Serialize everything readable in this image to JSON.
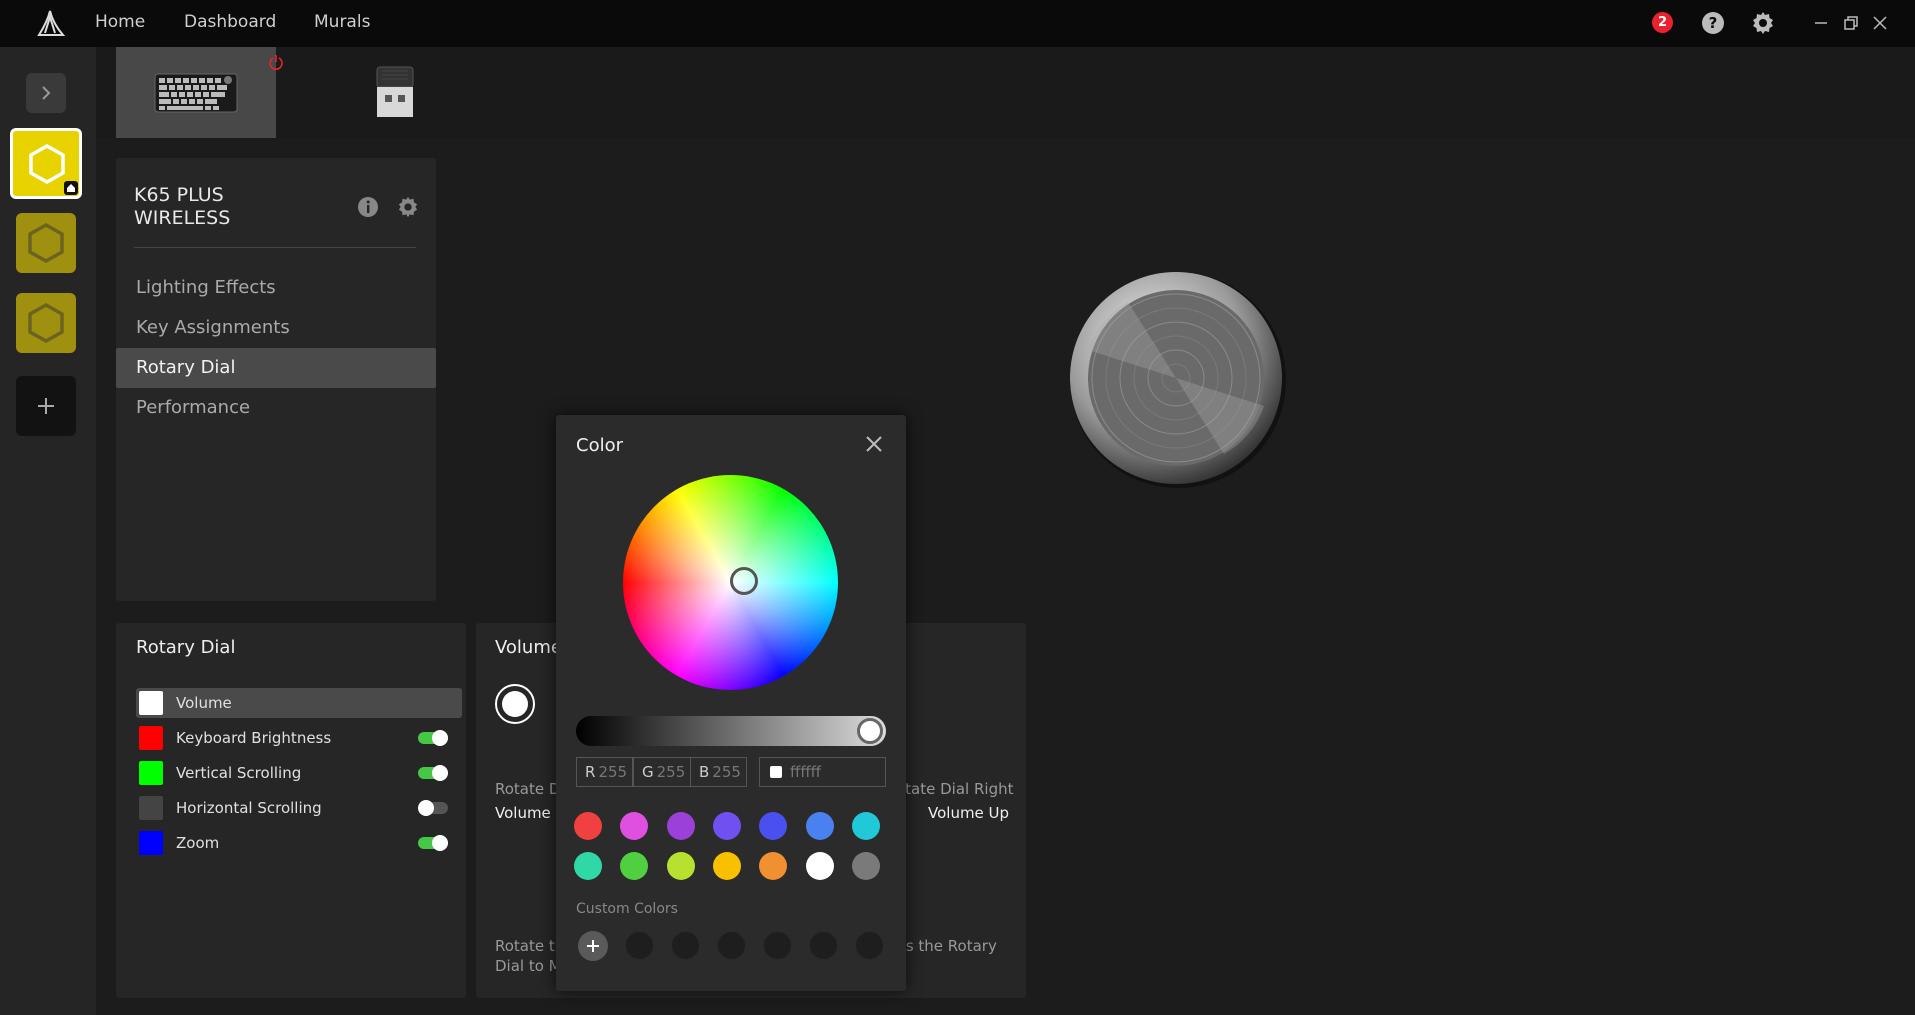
{
  "nav": {
    "home": "Home",
    "dashboard": "Dashboard",
    "murals": "Murals",
    "notification_count": "2"
  },
  "device": {
    "name_line1": "K65 PLUS",
    "name_line2": "WIRELESS",
    "menu": [
      "Lighting Effects",
      "Key Assignments",
      "Rotary Dial",
      "Performance"
    ],
    "active_menu": "Rotary Dial"
  },
  "rotary_dial": {
    "title": "Rotary Dial",
    "modes": [
      {
        "label": "Volume",
        "color": "#ffffff",
        "selected": true,
        "toggle": null
      },
      {
        "label": "Keyboard Brightness",
        "color": "#ff0000",
        "toggle": true
      },
      {
        "label": "Vertical Scrolling",
        "color": "#00ff00",
        "toggle": true
      },
      {
        "label": "Horizontal Scrolling",
        "color": "#444444",
        "toggle": false
      },
      {
        "label": "Zoom",
        "color": "#0000ff",
        "toggle": true
      }
    ]
  },
  "volume_panel": {
    "title": "Volume",
    "rotate_left_label": "Rotate D",
    "rotate_left_action": "Volume D",
    "rotate_right_label": "otate Dial Right",
    "rotate_right_action": "Volume Up",
    "press_text_left_1": "Rotate th",
    "press_text_left_2": "Dial to M",
    "press_text_right": "ss the Rotary"
  },
  "color_dialog": {
    "title": "Color",
    "r_label": "R",
    "r": "255",
    "g_label": "G",
    "g": "255",
    "b_label": "B",
    "b": "255",
    "hex": "ffffff",
    "brightness": 1.0,
    "presets": [
      "#f04040",
      "#e050e0",
      "#9b40d8",
      "#7050f0",
      "#4a50f0",
      "#4a80f0",
      "#20c8d8",
      "#30d8a8",
      "#50d040",
      "#b8e030",
      "#f8c000",
      "#f09030",
      "#ffffff",
      "#7a7a7a"
    ],
    "custom_colors_label": "Custom Colors"
  },
  "colors": {
    "accent_yellow": "#e8d200",
    "toggle_on": "#46c846"
  }
}
